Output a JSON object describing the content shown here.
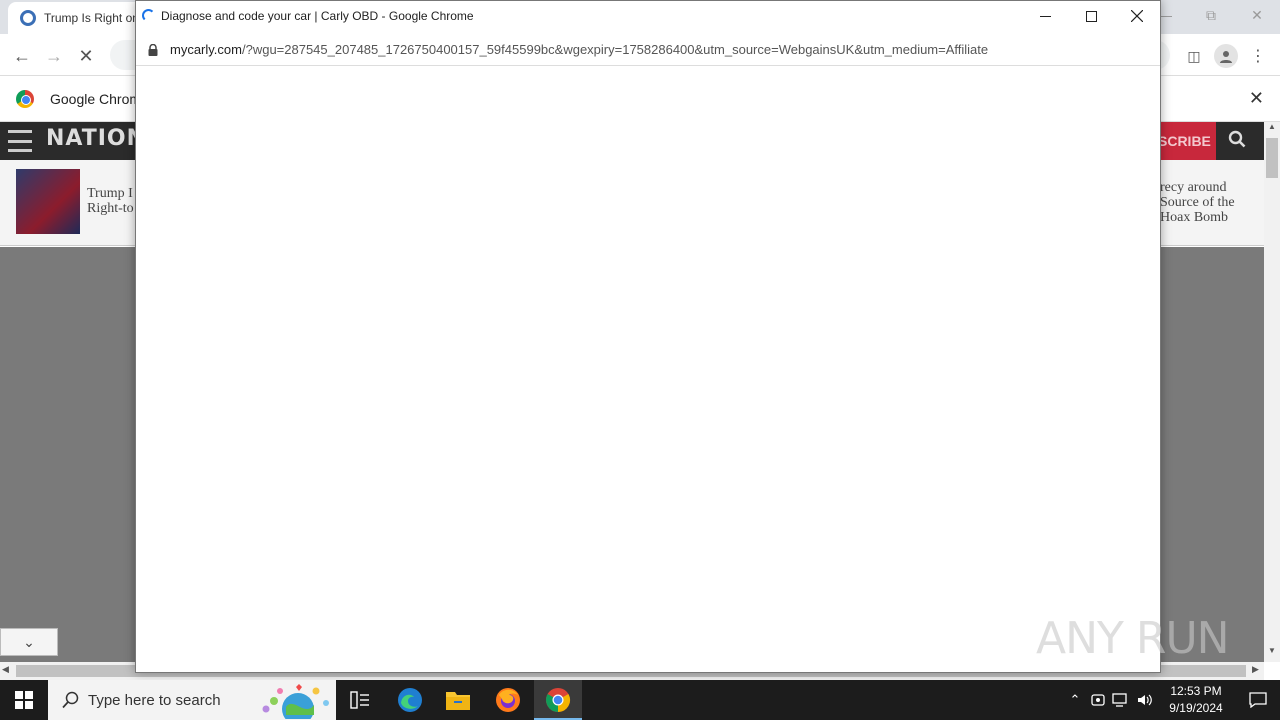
{
  "background_window": {
    "tab_title": "Trump Is Right on",
    "infobar_text": "Google Chrom",
    "site_logo": "NATION",
    "subscribe_label": "SCRIBE",
    "ticker_left": "Trump I Right-to",
    "ticker_right": "recy around Source of the Hoax Bomb"
  },
  "popup": {
    "title": "Diagnose and code your car | Carly OBD - Google Chrome",
    "url_host": "mycarly.com",
    "url_rest": "/?wgu=287545_207485_1726750400157_59f45599bc&wgexpiry=1758286400&utm_source=WebgainsUK&utm_medium=Affiliate"
  },
  "taskbar": {
    "search_placeholder": "Type here to search",
    "time": "12:53 PM",
    "date": "9/19/2024"
  },
  "watermark": "ANY RUN"
}
